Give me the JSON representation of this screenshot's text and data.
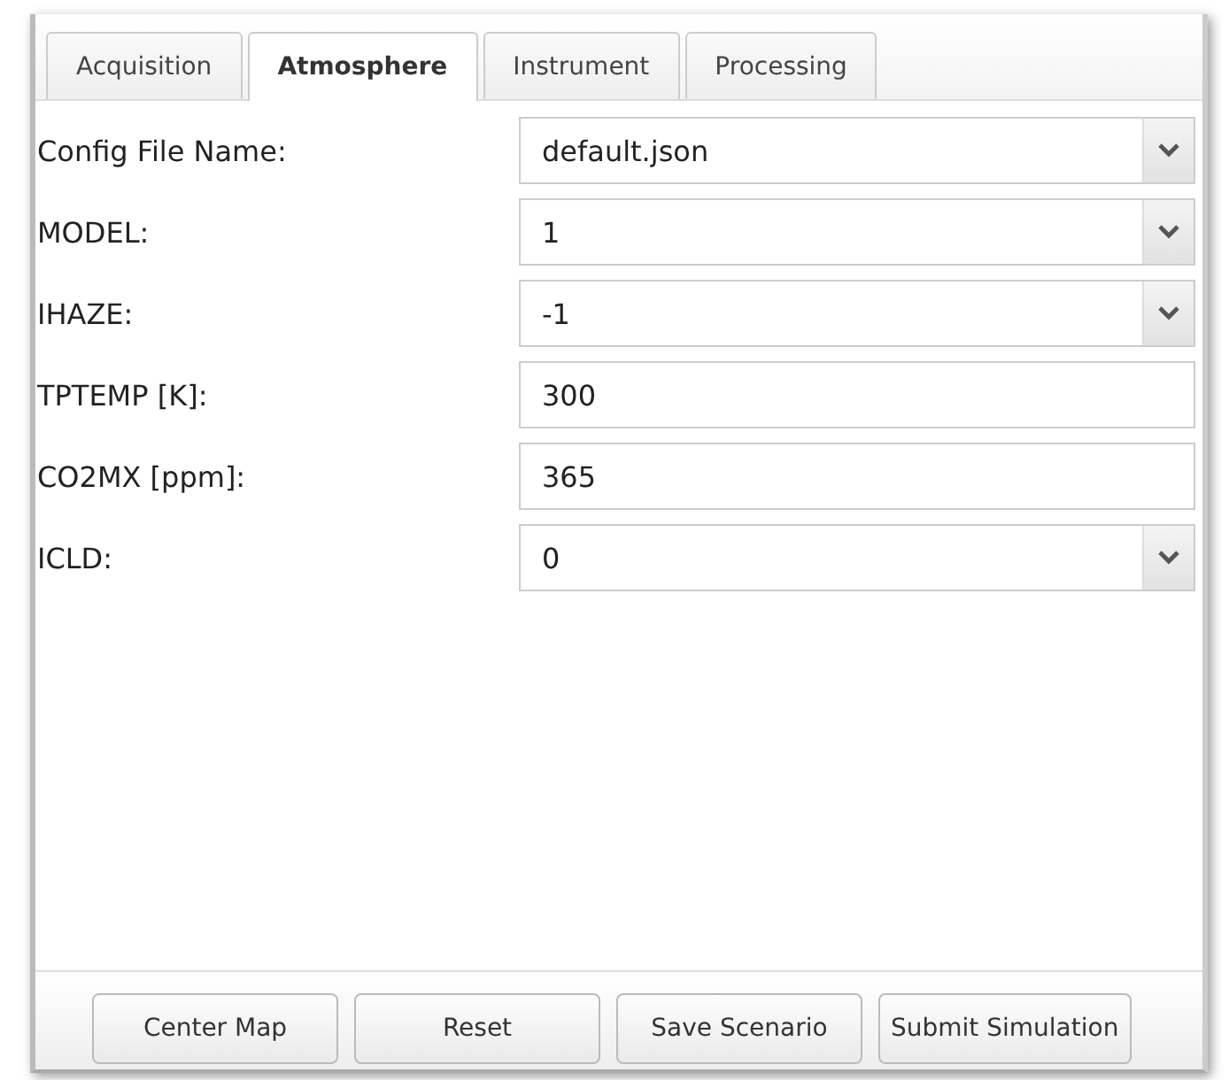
{
  "tabs": [
    {
      "label": "Acquisition",
      "selected": false
    },
    {
      "label": "Atmosphere",
      "selected": true
    },
    {
      "label": "Instrument",
      "selected": false
    },
    {
      "label": "Processing",
      "selected": false
    }
  ],
  "fields": [
    {
      "label": "Config File Name:",
      "kind": "select",
      "value": "default.json"
    },
    {
      "label": "MODEL:",
      "kind": "select",
      "value": "1"
    },
    {
      "label": "IHAZE:",
      "kind": "select",
      "value": "-1"
    },
    {
      "label": "TPTEMP [K]:",
      "kind": "text",
      "value": "300"
    },
    {
      "label": "CO2MX [ppm]:",
      "kind": "text",
      "value": "365"
    },
    {
      "label": "ICLD:",
      "kind": "select",
      "value": "0"
    }
  ],
  "buttons": [
    "Center Map",
    "Reset",
    "Save Scenario",
    "Submit Simulation"
  ]
}
